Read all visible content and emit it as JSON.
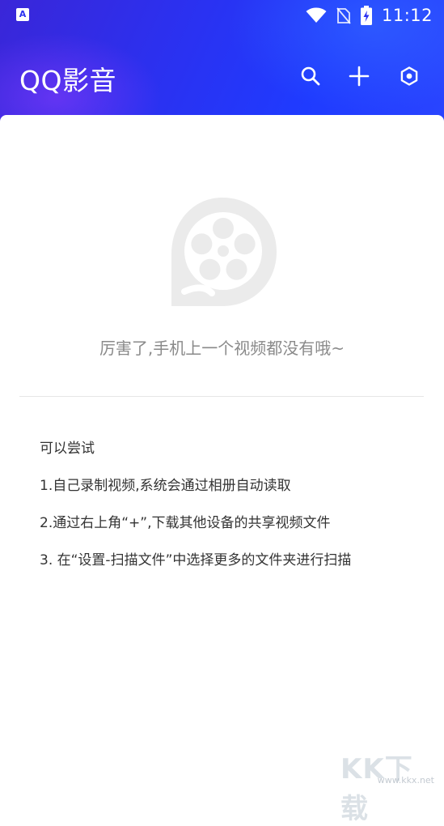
{
  "status_bar": {
    "time": "11:12",
    "icons": [
      "app-notification-icon",
      "wifi-icon",
      "no-sim-icon",
      "battery-charging-icon"
    ]
  },
  "app_bar": {
    "title": "QQ影音",
    "actions": [
      "search-icon",
      "add-icon",
      "settings-icon"
    ]
  },
  "empty_state": {
    "logo": "qq-player-film-reel-logo",
    "message": "厉害了,手机上一个视频都没有哦~"
  },
  "tips": {
    "heading": "可以尝试",
    "items": [
      "1.自己录制视频,系统会通过相册自动读取",
      "2.通过右上角“+”,下载其他设备的共享视频文件",
      "3. 在“设置-扫描文件”中选择更多的文件夹进行扫描"
    ]
  },
  "watermark": {
    "main": "KK下载",
    "sub": "www.kkx.net"
  },
  "colors": {
    "header_start": "#3a26d8",
    "header_end": "#2a45ff",
    "empty_text": "#8a8a8a",
    "logo_gray": "#ebebeb"
  }
}
